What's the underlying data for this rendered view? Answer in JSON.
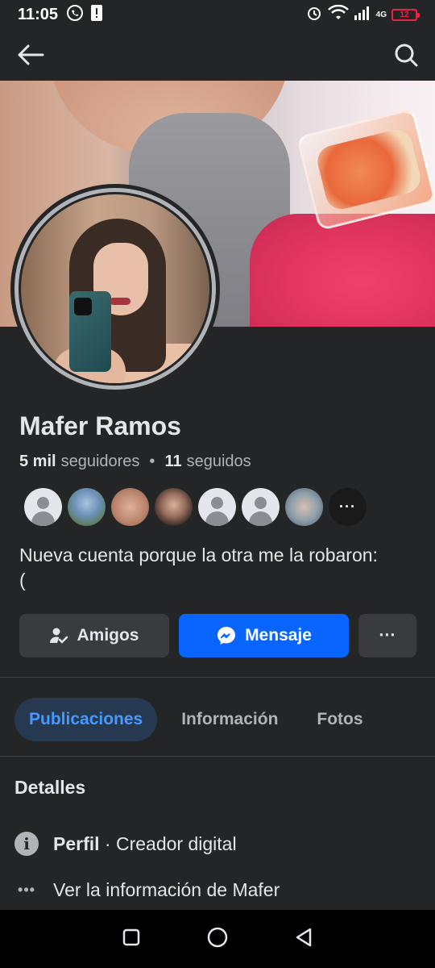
{
  "status_bar": {
    "time": "11:05",
    "network": "4G",
    "battery": "12"
  },
  "profile": {
    "name": "Mafer Ramos",
    "followers_count": "5 mil",
    "followers_label": "seguidores",
    "following_count": "11",
    "following_label": "seguidos",
    "bio": "Nueva cuenta porque la otra me la robaron:\n("
  },
  "friends_preview": [
    {
      "type": "default"
    },
    {
      "type": "photo",
      "color": "#6b8fb5"
    },
    {
      "type": "photo",
      "color": "#b8836a"
    },
    {
      "type": "photo",
      "color": "#4a3a30"
    },
    {
      "type": "default"
    },
    {
      "type": "default"
    },
    {
      "type": "photo",
      "color": "#8fa0ad"
    },
    {
      "type": "more",
      "label": "···"
    }
  ],
  "actions": {
    "friends_label": "Amigos",
    "message_label": "Mensaje",
    "more_label": "···"
  },
  "tabs": [
    {
      "label": "Publicaciones",
      "active": true
    },
    {
      "label": "Información",
      "active": false
    },
    {
      "label": "Fotos",
      "active": false
    }
  ],
  "details": {
    "title": "Detalles",
    "profile_label": "Perfil",
    "profile_value": " · Creador digital",
    "see_info": "Ver la información de Mafer"
  },
  "colors": {
    "background": "#242526",
    "accent": "#0866ff",
    "active_tab_bg": "#263951",
    "active_tab_text": "#4599ff"
  }
}
